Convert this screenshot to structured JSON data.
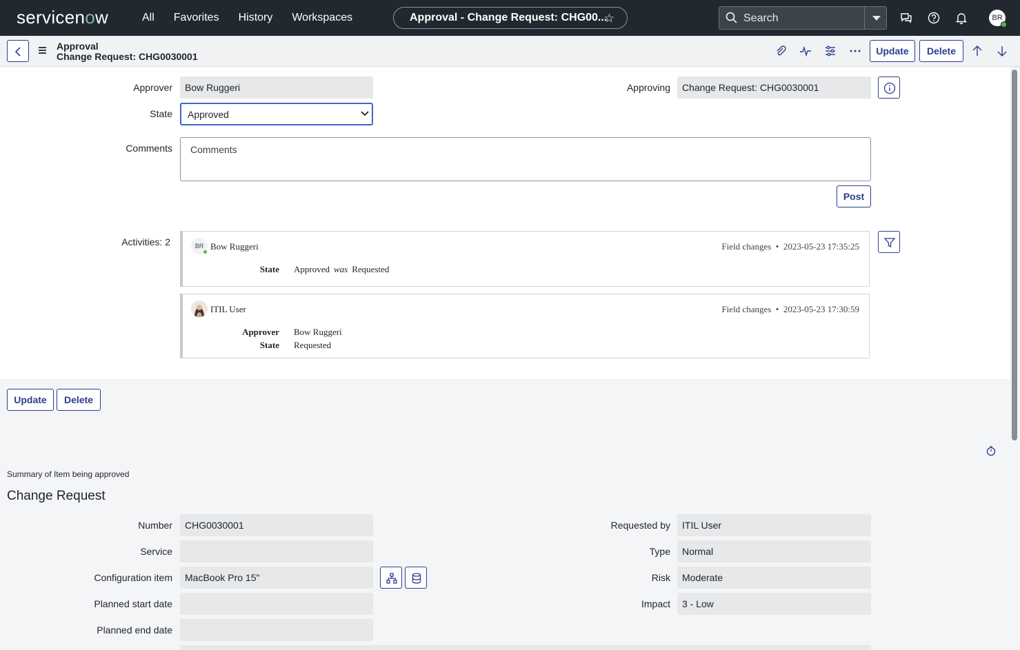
{
  "nav": {
    "logo_pre": "servicen",
    "logo_o": "o",
    "logo_post": "w",
    "links": [
      "All",
      "Favorites",
      "History",
      "Workspaces"
    ],
    "title": "Approval - Change Request: CHG00...",
    "search_placeholder": "Search",
    "user_initials": "BR"
  },
  "form_header": {
    "title_line1": "Approval",
    "title_line2": "Change Request: CHG0030001",
    "update_label": "Update",
    "delete_label": "Delete"
  },
  "approval": {
    "approver_label": "Approver",
    "approver_value": "Bow Ruggeri",
    "approving_label": "Approving",
    "approving_value": "Change Request: CHG0030001",
    "state_label": "State",
    "state_value": "Approved",
    "comments_label": "Comments",
    "comments_placeholder": "Comments",
    "post_label": "Post",
    "activities_label": "Activities: 2"
  },
  "activities": [
    {
      "initials": "BR",
      "user": "Bow Ruggeri",
      "type": "Field changes",
      "timestamp": "2023-05-23 17:35:25",
      "changes": [
        {
          "field": "State",
          "new": "Approved",
          "was_word": "was",
          "old": "Requested"
        }
      ]
    },
    {
      "user": "ITIL User",
      "type": "Field changes",
      "timestamp": "2023-05-23 17:30:59",
      "changes": [
        {
          "field": "Approver",
          "new": "Bow Ruggeri"
        },
        {
          "field": "State",
          "new": "Requested"
        }
      ]
    }
  ],
  "bottom_buttons": {
    "update_label": "Update",
    "delete_label": "Delete"
  },
  "summary": {
    "small_title": "Summary of Item being approved",
    "section_title": "Change Request",
    "left_fields": [
      {
        "label": "Number",
        "value": "CHG0030001"
      },
      {
        "label": "Service",
        "value": ""
      },
      {
        "label": "Configuration item",
        "value": "MacBook Pro 15\""
      },
      {
        "label": "Planned start date",
        "value": ""
      },
      {
        "label": "Planned end date",
        "value": ""
      }
    ],
    "right_fields": [
      {
        "label": "Requested by",
        "value": "ITIL User"
      },
      {
        "label": "Type",
        "value": "Normal"
      },
      {
        "label": "Risk",
        "value": "Moderate"
      },
      {
        "label": "Impact",
        "value": "3 - Low"
      }
    ]
  },
  "colors": {
    "nav_bg": "#212830",
    "accent": "#293e8f",
    "field_bg": "#e6e8ea",
    "focus": "#3d67c9",
    "presence": "#52b44a"
  }
}
